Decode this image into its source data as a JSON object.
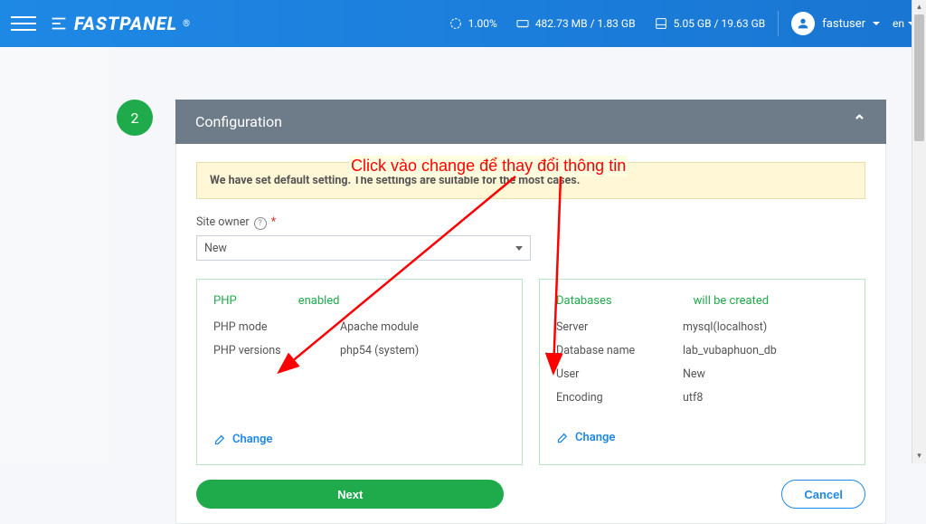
{
  "header": {
    "logo": "FASTPANEL",
    "cpu": "1.00%",
    "memory": "482.73 MB / 1.83 GB",
    "disk": "5.05 GB / 19.63 GB",
    "user": "fastuser",
    "lang": "en"
  },
  "step": {
    "number": "2",
    "title": "Configuration"
  },
  "notice": "We have set default setting. The settings are suitable for the most cases.",
  "field": {
    "owner_label": "Site owner",
    "owner_value": "New"
  },
  "php_card": {
    "title": "PHP",
    "status": "enabled",
    "rows": [
      {
        "k": "PHP mode",
        "v": "Apache module"
      },
      {
        "k": "PHP versions",
        "v": "php54 (system)"
      }
    ],
    "change": "Change"
  },
  "db_card": {
    "title": "Databases",
    "status": "will be created",
    "rows": [
      {
        "k": "Server",
        "v": "mysql(localhost)"
      },
      {
        "k": "Database name",
        "v": "lab_vubaphuon_db"
      },
      {
        "k": "User",
        "v": "New"
      },
      {
        "k": "Encoding",
        "v": "utf8"
      }
    ],
    "change": "Change"
  },
  "buttons": {
    "next": "Next",
    "cancel": "Cancel"
  },
  "annotation": "Click vào change để thay đổi thông tin"
}
